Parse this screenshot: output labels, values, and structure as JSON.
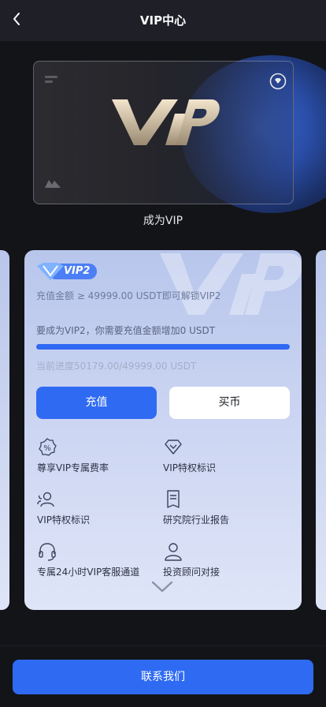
{
  "header": {
    "title": "VIP中心"
  },
  "hero": {
    "become_label": "成为VIP"
  },
  "level_card": {
    "badge": "VIP2",
    "requirement": "充值金额 ≥ 49999.00 USDT即可解锁VIP2",
    "need_text": "要成为VIP2，你需要充值金额增加0 USDT",
    "progress_text": "当前进度50179.00/49999.00 USDT",
    "progress_fraction": 1.0,
    "recharge_label": "充值",
    "buy_label": "买币",
    "features": [
      {
        "icon": "percent-badge-icon",
        "label": "尊享VIP专属费率"
      },
      {
        "icon": "diamond-icon",
        "label": "VIP特权标识"
      },
      {
        "icon": "users-icon",
        "label": "VIP特权标识"
      },
      {
        "icon": "report-icon",
        "label": "研究院行业报告"
      },
      {
        "icon": "headset-icon",
        "label": "专属24小时VIP客服通道"
      },
      {
        "icon": "user-icon",
        "label": "投资顾问对接"
      }
    ]
  },
  "footer": {
    "contact_label": "联系我们"
  },
  "colors": {
    "accent": "#2f6bf2",
    "background": "#131418",
    "header": "#1e1f27"
  }
}
